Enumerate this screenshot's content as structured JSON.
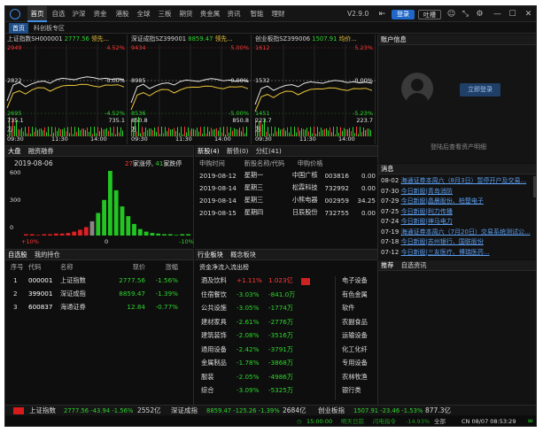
{
  "nav": [
    "首页",
    "自选",
    "沪深",
    "资金",
    "港股",
    "全球",
    "三板",
    "期货",
    "贵金属",
    "资讯",
    "智能",
    "理财"
  ],
  "version": "V2.9.0",
  "topbtns": {
    "login": "登录",
    "hot": "吐槽"
  },
  "subtabs": [
    "首页",
    "科创板专区"
  ],
  "minis": [
    {
      "name": "上证指数",
      "code": "SH000001",
      "price": "2777.56",
      "tag": "领先...",
      "hi": "2949",
      "hipct": "4.52%",
      "mid": "2822",
      "midpct": "0.00%",
      "lo": "2695",
      "lopct": "-4.52%",
      "vol": "735.1",
      "vu": "万",
      "t": [
        "09:30",
        "11:30",
        "14:00"
      ]
    },
    {
      "name": "深证成指",
      "code": "SZ399001",
      "price": "8859.47",
      "tag": "领先...",
      "hi": "9434",
      "hipct": "5.00%",
      "mid": "8985",
      "midpct": "0.00%",
      "lo": "8536",
      "lopct": "-5.00%",
      "vol": "850.8",
      "vu": "万",
      "t": [
        "09:30",
        "11:30",
        "14:00"
      ]
    },
    {
      "name": "创业板指",
      "code": "SZ399006",
      "price": "1507.91",
      "tag": "均价...",
      "hi": "1612",
      "hipct": "5.23%",
      "mid": "1532",
      "midpct": "0.00%",
      "lo": "1451",
      "lopct": "-5.23%",
      "vol": "223.7",
      "vu": "万",
      "t": [
        "09:30",
        "11:30",
        "14:00"
      ]
    }
  ],
  "account": {
    "title": "账户信息",
    "login": "立即登录",
    "hint": "登陆后查看资产明细"
  },
  "market": {
    "tabs": [
      "大盘",
      "融资融券"
    ],
    "date": "2019-08-06",
    "upn": "27",
    "upl": "家涨停,",
    "dnn": "41",
    "dnl": "家跌停",
    "y": [
      "600",
      "300",
      "0"
    ],
    "xl": "+10%",
    "xm": "0",
    "xr": "-10%",
    "bars": [
      2,
      2,
      1,
      2,
      2,
      3,
      3,
      4,
      6,
      9,
      13,
      22,
      35,
      55,
      100,
      70,
      45,
      30,
      18,
      10,
      6,
      4,
      3,
      2,
      2,
      1,
      2,
      2
    ]
  },
  "ipo": {
    "tabs": [
      "新股(4)",
      "新债(0)",
      "分红(41)"
    ],
    "headers": [
      "申购时间",
      "新股名称/代码",
      "申购价格"
    ],
    "rows": [
      [
        "2019-08-12",
        "星期一",
        "中国广核",
        "003816",
        "0.00"
      ],
      [
        "2019-08-14",
        "星期三",
        "松霖科技",
        "732992",
        "0.00"
      ],
      [
        "2019-08-14",
        "星期三",
        "小熊电器",
        "002959",
        "34.25"
      ],
      [
        "2019-08-15",
        "星期四",
        "日辰股份",
        "732755",
        "0.00"
      ]
    ]
  },
  "news": {
    "title": "消息",
    "items": [
      [
        "08-02",
        "海通证券本周六（8月3日）暂停开户及交易..."
      ],
      [
        "07-30",
        "今日新股|青岛消防"
      ],
      [
        "07-29",
        "今日新股|晶晨股份、柏楚电子"
      ],
      [
        "07-25",
        "今日新股|利力传播"
      ],
      [
        "07-24",
        "今日新股|神马电力"
      ],
      [
        "07-19",
        "海通证券本周六（7月20日）交易系统测试公..."
      ],
      [
        "07-18",
        "今日新股|苏州银行、国联股份"
      ],
      [
        "07-12",
        "今日新股|三友医疗、博瑞医药..."
      ]
    ]
  },
  "watch": {
    "tabs": [
      "自选股",
      "我的持仓"
    ],
    "headers": [
      "序号",
      "代码",
      "名称",
      "现价",
      "涨幅"
    ],
    "rows": [
      [
        "1",
        "000001",
        "上证指数",
        "2777.56",
        "-1.56%"
      ],
      [
        "2",
        "399001",
        "深证成指",
        "8859.47",
        "-1.39%"
      ],
      [
        "3",
        "600837",
        "海通证券",
        "12.84",
        "-0.77%"
      ]
    ]
  },
  "sector": {
    "tabs": [
      "行业板块",
      "概念板块"
    ],
    "sub": "资金净流入流出榜",
    "rows": [
      [
        "酒及饮料",
        "+1.11%",
        "1.023亿"
      ],
      [
        "住宿餐饮",
        "-3.03%",
        "-841.0万"
      ],
      [
        "公共设施",
        "-3.05%",
        "-1774万"
      ],
      [
        "建材家具",
        "-2.61%",
        "-2776万"
      ],
      [
        "建筑装饰",
        "-2.08%",
        "-3516万"
      ],
      [
        "通用设备",
        "-2.42%",
        "-3791万"
      ],
      [
        "金属制品",
        "-1.78%",
        "-3868万"
      ],
      [
        "服装",
        "-2.05%",
        "-4986万"
      ],
      [
        "综合",
        "-3.09%",
        "-5325万"
      ]
    ],
    "right": [
      "电子设备",
      "有色金属",
      "软件",
      "农副食品",
      "运输设备",
      "化工化纤",
      "专用设备",
      "农林牧渔",
      "银行类"
    ]
  },
  "recommend": {
    "tabs": [
      "推荐",
      "自选资讯"
    ]
  },
  "footer": {
    "i1": "上证指数",
    "v1": "2777.56 -43.94 -1.56%",
    "a1": "2552亿",
    "i2": "深证成指",
    "v2": "8859.47 -125.26 -1.39%",
    "a2": "2684亿",
    "i3": "创业板指",
    "v3": "1507.91 -23.46 -1.53%",
    "a3": "877.3亿",
    "time": "15:00:00",
    "s1": "明天日前",
    "s2": "闪电指令",
    "s3": "-14.93%",
    "s4": "全部",
    "clock": "CN 08/07 08:53:29"
  }
}
